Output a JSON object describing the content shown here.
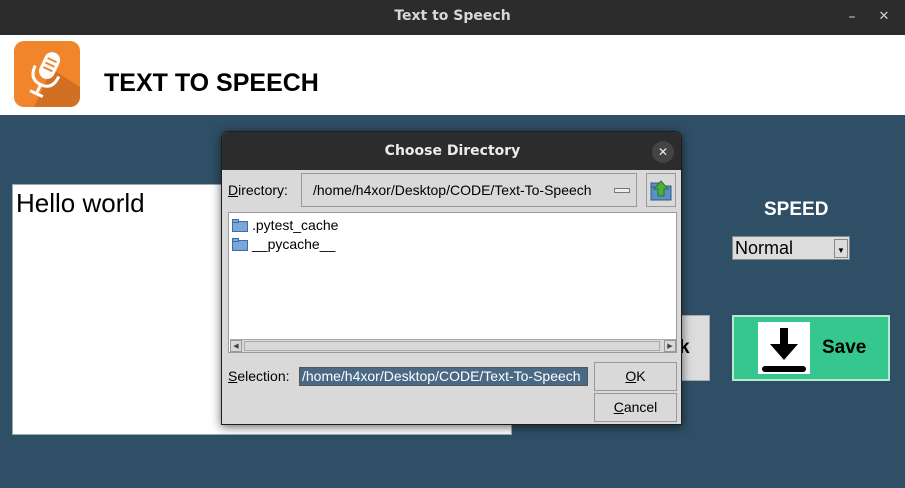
{
  "window": {
    "title": "Text to Speech",
    "minimize_glyph": "–",
    "close_glyph": "✕"
  },
  "header": {
    "logo_icon": "microphone-icon",
    "title": "TEXT TO SPEECH"
  },
  "main": {
    "text_value": "Hello world",
    "speed_label": "SPEED",
    "speed_selected": "Normal",
    "partial_button_label": "k",
    "save_label": "Save",
    "save_icon": "download-icon"
  },
  "colors": {
    "body_bg": "#2f4f66",
    "save_bg": "#36c78e",
    "logo_bg": "#f0852c",
    "selection_bg": "#4a6984"
  },
  "dialog": {
    "title": "Choose Directory",
    "close_glyph": "✕",
    "directory_label_first": "D",
    "directory_label_rest": "irectory:",
    "directory_value": "/home/h4xor/Desktop/CODE/Text-To-Speech",
    "files": [
      {
        "name": ".pytest_cache"
      },
      {
        "name": "__pycache__"
      }
    ],
    "selection_label_first": "S",
    "selection_label_rest": "election:",
    "selection_value": "/home/h4xor/Desktop/CODE/Text-To-Speech",
    "ok_first": "O",
    "ok_rest": "K",
    "cancel_first": "C",
    "cancel_rest": "ancel"
  }
}
